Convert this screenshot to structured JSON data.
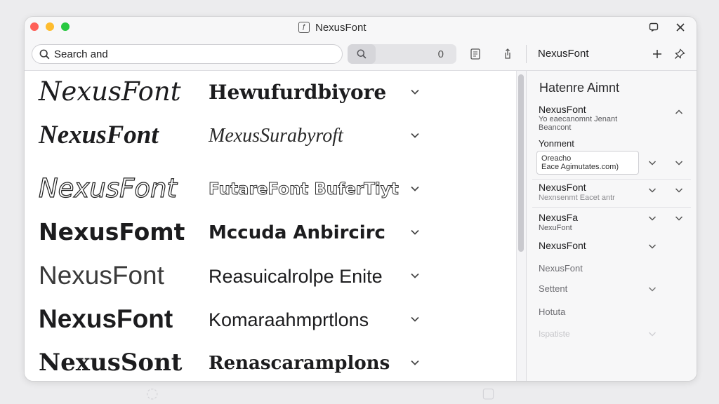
{
  "window": {
    "title": "NexusFont",
    "app_icon": "font-app-icon"
  },
  "toolbar": {
    "search_text": "Search and",
    "count": "0",
    "panel_title": "NexusFont"
  },
  "font_list": [
    {
      "name": "NexusFont",
      "sample": "Hewufurdbiyore"
    },
    {
      "name": "NexusFont",
      "sample": "MexusSurabyroft"
    },
    {
      "name": "NexusFont",
      "sample": "FutareFont BuferTiyt"
    },
    {
      "name": "NexusFomt",
      "sample": "Mccuda Anbircirc"
    },
    {
      "name": "NexusFont",
      "sample": "Reasuicalrolpe Enite"
    },
    {
      "name": "NexusFont",
      "sample": "Komaraahmprtlons"
    },
    {
      "name": "NexusSont",
      "sample": "Renascaramplons"
    }
  ],
  "side_panel": {
    "heading": "Hatenre Aimnt",
    "group1": {
      "title": "NexusFont",
      "sub_line1": "Yo eaecanomnt Jenant",
      "sub_line2": "Beancont"
    },
    "section_label": "Yonment",
    "input_line1": "Oreacho",
    "input_line2": "Eace Agimutates.com)",
    "group2": {
      "title": "NexusFont",
      "sub": "Nexnsenmt Eacet antr"
    },
    "group3": {
      "title": "NexusFa",
      "sub": "NexuFont"
    },
    "item_a": "NexusFont",
    "item_b": "NexusFont",
    "item_c": "Settent",
    "item_d": "Hotuta",
    "item_e": "Ispatiste"
  }
}
